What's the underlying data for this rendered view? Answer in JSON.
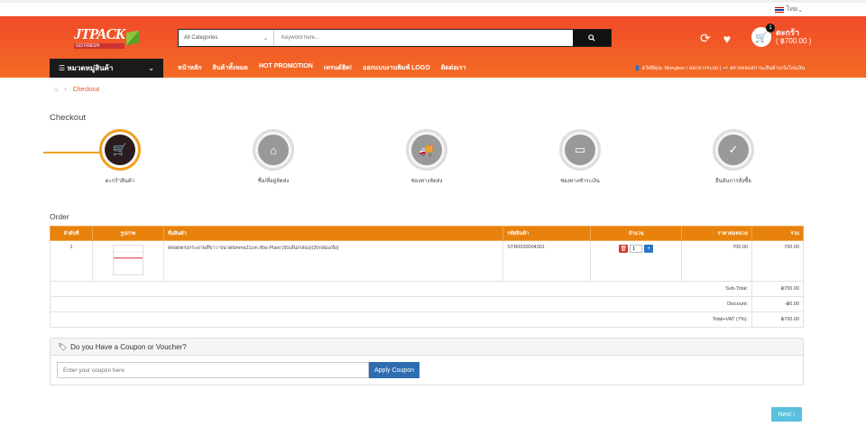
{
  "topbar": {
    "language": "ไทย"
  },
  "header": {
    "logo_main": "JTPACK",
    "logo_sub": "GO FRESH",
    "search_category": "All Categories",
    "search_placeholder": "Keyword here...",
    "cart_count": "1",
    "cart_label": "ตะกร้า",
    "cart_total": "( ฿700.00 )"
  },
  "nav": {
    "category_menu": "หมวดหมู่สินค้า",
    "links": [
      "หน้าหลัก",
      "สินค้าทั้งหมด",
      "HOT PROMOTION",
      "เทรนด์ฮิต!",
      "ออกแบบงานพิมพ์ LOGO",
      "ติดต่อเรา"
    ],
    "user_greeting": "สวัสดีคุณ: Mongkon / ออกจากระบบ",
    "check_payment": "ตรวจสอบสถานะสินค้า/แจ้งโอนเงิน"
  },
  "breadcrumb": {
    "current": "Checkout"
  },
  "page_title": "Checkout",
  "steps": [
    {
      "label": "ตะกร้าสินค้า",
      "icon": "shopping-cart-icon",
      "active": true
    },
    {
      "label": "ชื่อ/ที่อยู่จัดส่ง",
      "icon": "house-search-icon",
      "active": false
    },
    {
      "label": "ช่องทางจัดส่ง",
      "icon": "delivery-truck-icon",
      "active": false
    },
    {
      "label": "ช่องทางชำระเงิน",
      "icon": "payment-card-icon",
      "active": false
    },
    {
      "label": "ยืนยันการสั่งซื้อ",
      "icon": "clipboard-check-icon",
      "active": false
    }
  ],
  "order": {
    "title": "Order",
    "columns": [
      "ลำดับที่",
      "รูปภาพ",
      "ชื่อสินค้า",
      "รหัสสินค้า",
      "จำนวน",
      "ราคาต่อหน่วย",
      "รวม"
    ],
    "rows": [
      {
        "no": "1",
        "name": "หลอดตรงกระดาษสีขาว ขนาด6mmx21cm /Bio Plant (50เส้น/กล่อง)(20กล่อง/ลัง)",
        "code": "STR0030004301",
        "qty": "1",
        "unit_price": "700.00",
        "total": "700.00"
      }
    ],
    "subtotal_label": "Sub-Total:",
    "subtotal": "฿700.00",
    "discount_label": "Discount:",
    "discount": "-฿0.00",
    "vat_label": "Total+VAT (7%):",
    "vat_total": "฿700.00"
  },
  "coupon": {
    "title": "Do you Have a Coupon or Voucher?",
    "placeholder": "Enter your coupon here",
    "button": "Apply Coupon"
  },
  "next_button": "Next"
}
